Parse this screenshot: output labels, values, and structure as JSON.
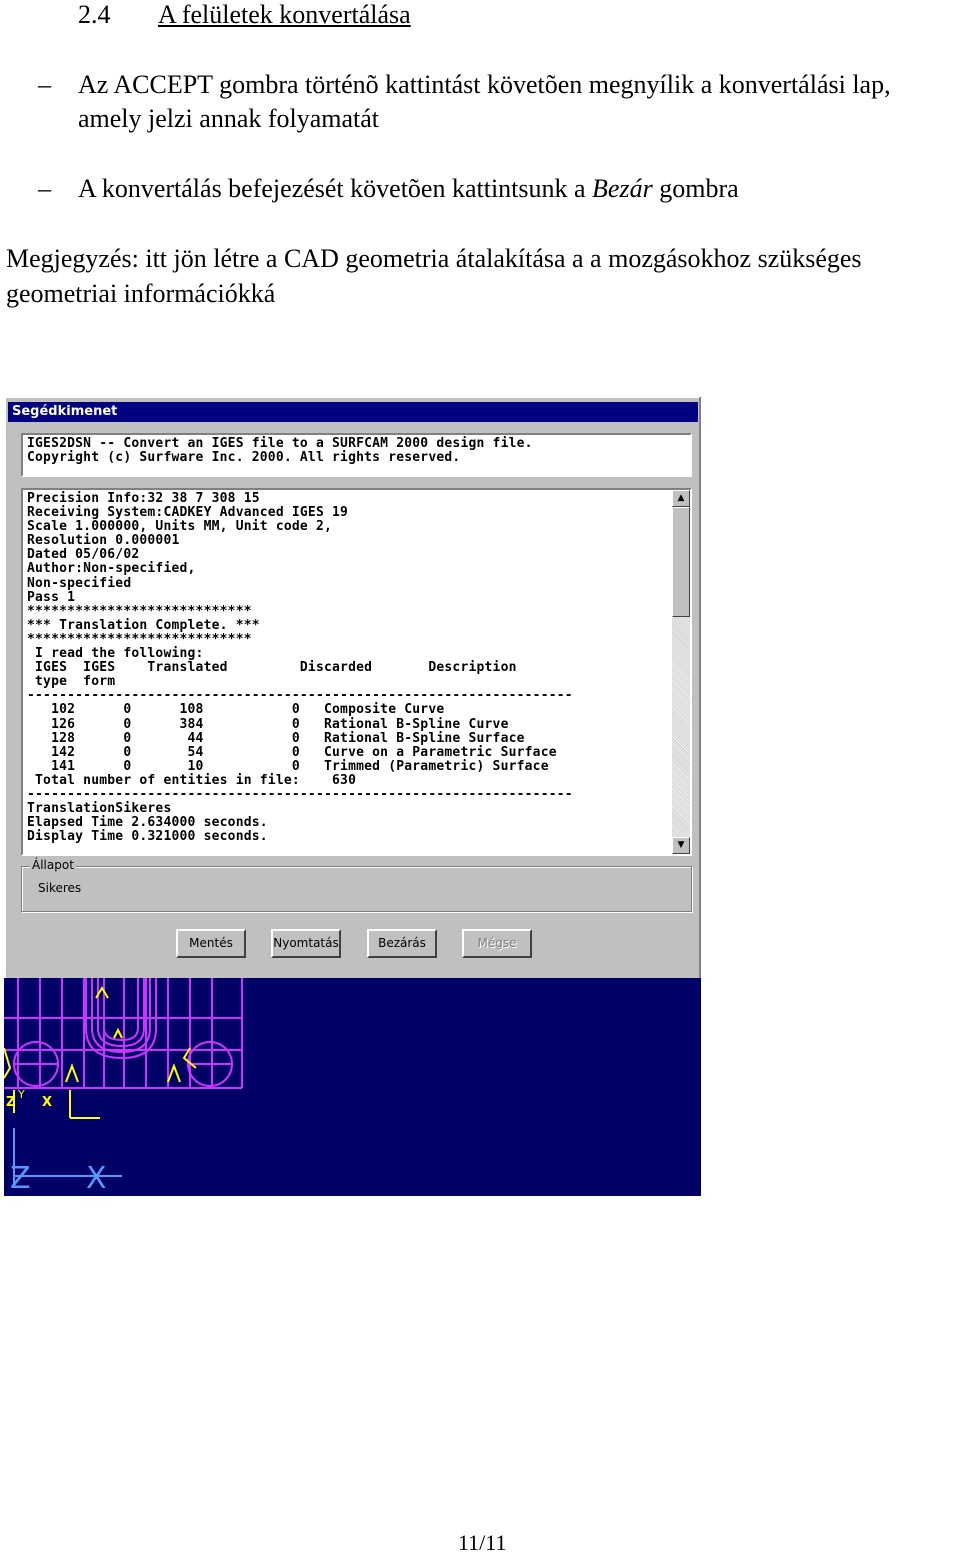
{
  "heading": {
    "number": "2.4",
    "title": "A felületek konvertálása"
  },
  "bullets": [
    {
      "dash": "–",
      "text": "Az ACCEPT gombra történõ kattintást követõen megnyílik a konvertálási lap, amely jelzi annak folyamatát"
    },
    {
      "dash": "–",
      "text_before": "A konvertálás befejezését követõen kattintsunk a ",
      "text_italic": "Bezár",
      "text_after": " gombra"
    }
  ],
  "note": "Megjegyzés: itt jön létre a CAD geometria átalakítása a a mozgásokhoz szükséges geometriai információkká",
  "screenshot": {
    "window_title": "Segédkimenet",
    "header_lines": "IGES2DSN -- Convert an IGES file to a SURFCAM 2000 design file.\nCopyright (c) Surfware Inc. 2000. All rights reserved.",
    "log_lines": "Precision Info:32 38 7 308 15\nReceiving System:CADKEY Advanced IGES 19\nScale 1.000000, Units MM, Unit code 2,\nResolution 0.000001\nDated 05/06/02\nAuthor:Non-specified,\nNon-specified\nPass 1\n****************************\n*** Translation Complete. ***\n****************************\n I read the following:\n IGES  IGES    Translated         Discarded       Description\n type  form\n--------------------------------------------------------------------\n   102      0      108           0   Composite Curve\n   126      0      384           0   Rational B-Spline Curve\n   128      0       44           0   Rational B-Spline Surface\n   142      0       54           0   Curve on a Parametric Surface\n   141      0       10           0   Trimmed (Parametric) Surface\n Total number of entities in file:    630\n--------------------------------------------------------------------\nTranslationSikeres\nElapsed Time 2.634000 seconds.\nDisplay Time 0.321000 seconds.",
    "scroll_up": "▲",
    "scroll_down": "▼",
    "status_label": "Állapot",
    "status_value": "Sikeres",
    "buttons": {
      "save": "Mentés",
      "print": "Nyomtatás",
      "close": "Bezárás",
      "cancel": "Mégse"
    },
    "axis_labels": {
      "z1": "Z",
      "x1": "X",
      "y1": "Y",
      "z2": "Z",
      "x2": "X"
    },
    "colors": {
      "titlebar": "#000080",
      "cad_background": "#000066",
      "cad_magenta": "#cc33ff",
      "cad_yellow": "#ffff00",
      "cad_cyan": "#5599ff"
    }
  },
  "footer": {
    "page": "11/11"
  }
}
